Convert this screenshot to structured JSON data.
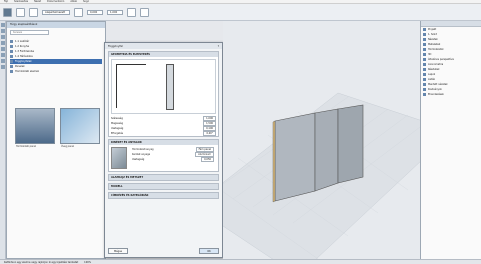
{
  "menubar": {
    "items": [
      "Fájl",
      "Szerkesztés",
      "Nézet",
      "Dokumentáció",
      "Ablak",
      "Súgó"
    ]
  },
  "toolbar": {
    "field1": "Alapértelmezett",
    "field2": "0,000",
    "field3": "1,000"
  },
  "library": {
    "title": "Tárgy alapbeállítások",
    "search_placeholder": "Keresés",
    "tree": [
      {
        "label": "1.1 Lakótér",
        "selected": false
      },
      {
        "label": "1.2 Konyha",
        "selected": false
      },
      {
        "label": "1.3 Fürdőszoba",
        "selected": false
      },
      {
        "label": "1.4 Hálószoba",
        "selected": false
      },
      {
        "label": "Függönyfalak",
        "selected": true
      },
      {
        "label": "Panelek",
        "selected": false
      },
      {
        "label": "Homlokzati elemek",
        "selected": false
      }
    ],
    "thumb1_label": "Homlokzati panel",
    "thumb2_label": "Üveg panel"
  },
  "dialog": {
    "title": "Függönyfal",
    "help": "?",
    "geometry_section": "GEOMETRIA ÉS ELHELYEZÉS",
    "rows": [
      {
        "label": "Szélesség",
        "value": "1,000"
      },
      {
        "label": "Magasság",
        "value": "1,500"
      },
      {
        "label": "Vastagság",
        "value": "0,100"
      },
      {
        "label": "Elforgatás",
        "value": "0,00°"
      }
    ],
    "material_section": "KINÉZET ÉS ANYAGOK",
    "material_rows": [
      {
        "label": "Homlokzati anyag",
        "value": "Fém panel"
      },
      {
        "label": "Kerület anyaga",
        "value": "Alumínium"
      },
      {
        "label": "Vastagság",
        "value": "0,050"
      }
    ],
    "extra_sections": [
      "ALAPRAJZ ÉS METSZET",
      "MODELL",
      "CÍMKÉZÉS ÉS KATEGÓRIÁK"
    ],
    "cancel": "Mégse",
    "ok": "OK"
  },
  "navigator": {
    "items": [
      "Projekt",
      "1. Szint",
      "Nézetek",
      "Metszetek",
      "Homlokzatok",
      "3D",
      "Általános perspektíva",
      "Axonometria",
      "Részletek",
      "Lapok",
      "Listák",
      "Mentett nézetek",
      "Kiadványok",
      "Elrendezések"
    ]
  },
  "status": {
    "text": "Kattintson egy elemre vagy rajzoljon ki egy kijelölési területet",
    "zoom": "100%"
  }
}
